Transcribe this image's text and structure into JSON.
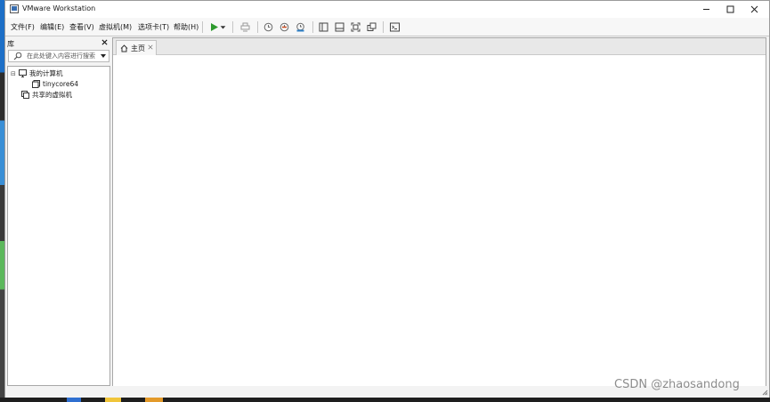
{
  "window": {
    "title": "VMware Workstation",
    "minimize": "minimize",
    "maximize": "maximize",
    "close": "close"
  },
  "menu": [
    {
      "label": "文件(F)"
    },
    {
      "label": "编辑(E)"
    },
    {
      "label": "查看(V)"
    },
    {
      "label": "虚拟机(M)"
    },
    {
      "label": "选项卡(T)"
    },
    {
      "label": "帮助(H)"
    }
  ],
  "toolbar": {
    "icons": [
      "play-icon",
      "dropdown-arrow-icon",
      "send-ctrl-alt-del-icon",
      "snapshot-icon",
      "revert-snapshot-icon",
      "snapshot-manager-icon",
      "show-library-icon",
      "thumbnail-bar-icon",
      "full-screen-icon",
      "unity-icon",
      "console-view-icon"
    ],
    "play_color": "#2e9a2e"
  },
  "library": {
    "title": "库",
    "search_placeholder": "在此处键入内容进行搜索",
    "tree": [
      {
        "label": "我的计算机",
        "expander": "⊟"
      },
      {
        "label": "tinycore64"
      },
      {
        "label": "共享的虚拟机"
      }
    ]
  },
  "tabs": [
    {
      "label": "主页"
    }
  ],
  "watermark": "CSDN @zhaosandong"
}
